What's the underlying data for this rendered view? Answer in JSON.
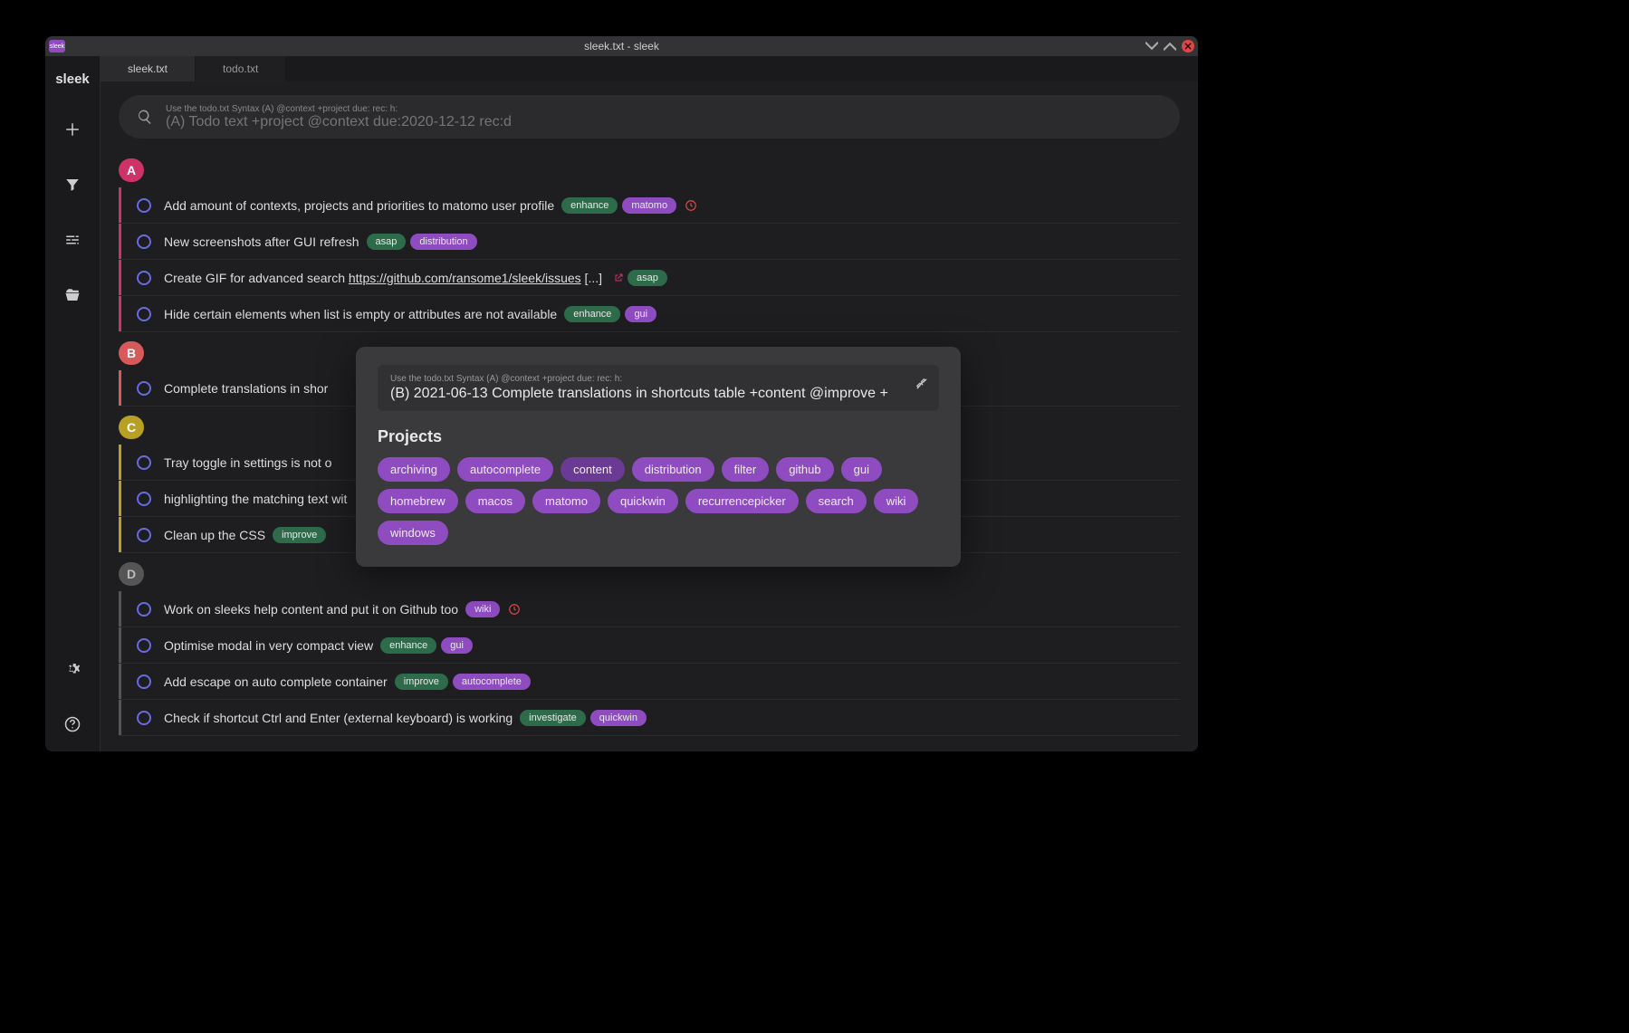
{
  "window": {
    "title": "sleek.txt - sleek",
    "app_icon_text": "sleek"
  },
  "sidebar": {
    "logo": "sleek"
  },
  "tabs": [
    {
      "label": "sleek.txt",
      "active": true
    },
    {
      "label": "todo.txt",
      "active": false
    }
  ],
  "search": {
    "hint": "Use the todo.txt Syntax (A) @context +project due: rec: h:",
    "placeholder": "(A) Todo text +project @context due:2020-12-12 rec:d"
  },
  "groups": [
    {
      "priority": "A",
      "items": [
        {
          "text": "Add amount of contexts, projects and priorities to matomo user profile",
          "tags": [
            [
              "enhance",
              "green"
            ],
            [
              "matomo",
              "purple"
            ]
          ],
          "clock": true
        },
        {
          "text": "New screenshots after GUI refresh",
          "tags": [
            [
              "asap",
              "green"
            ],
            [
              "distribution",
              "purple"
            ]
          ]
        },
        {
          "text_prefix": "Create GIF for advanced search ",
          "link": "https://github.com/ransome1/sleek/issues",
          "link_suffix": " [...]",
          "ext": true,
          "tags": [
            [
              "asap",
              "green"
            ]
          ]
        },
        {
          "text": "Hide certain elements when list is empty or attributes are not available",
          "tags": [
            [
              "enhance",
              "green"
            ],
            [
              "gui",
              "purple"
            ]
          ]
        }
      ]
    },
    {
      "priority": "B",
      "items": [
        {
          "text": "Complete translations in shor"
        }
      ]
    },
    {
      "priority": "C",
      "items": [
        {
          "text": "Tray toggle in settings is not o"
        },
        {
          "text": "highlighting the matching text wit"
        },
        {
          "text": "Clean up the CSS",
          "tags": [
            [
              "improve",
              "green"
            ]
          ]
        }
      ]
    },
    {
      "priority": "D",
      "items": [
        {
          "text": "Work on sleeks help content and put it on Github too",
          "tags": [
            [
              "wiki",
              "purple"
            ]
          ],
          "clock": true
        },
        {
          "text": "Optimise modal in very compact view",
          "tags": [
            [
              "enhance",
              "green"
            ],
            [
              "gui",
              "purple"
            ]
          ]
        },
        {
          "text": "Add escape on auto complete container",
          "tags": [
            [
              "improve",
              "green"
            ],
            [
              "autocomplete",
              "purple"
            ]
          ]
        },
        {
          "text": "Check if shortcut Ctrl and Enter (external keyboard) is working",
          "tags": [
            [
              "investigate",
              "green"
            ],
            [
              "quickwin",
              "purple"
            ]
          ]
        }
      ]
    }
  ],
  "modal": {
    "hint": "Use the todo.txt Syntax (A) @context +project due: rec: h:",
    "value": "(B) 2021-06-13 Complete translations in shortcuts table +content @improve +",
    "heading": "Projects",
    "projects": [
      "archiving",
      "autocomplete",
      "content",
      "distribution",
      "filter",
      "github",
      "gui",
      "homebrew",
      "macos",
      "matomo",
      "quickwin",
      "recurrencepicker",
      "search",
      "wiki",
      "windows"
    ],
    "active_project": "content"
  }
}
